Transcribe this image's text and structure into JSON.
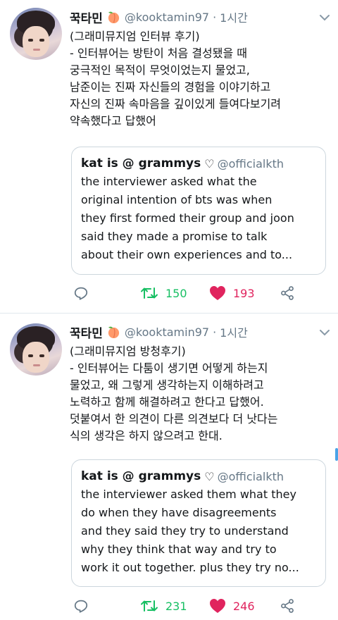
{
  "tweets": [
    {
      "author_name": "꾹타민",
      "handle": "@kooktamin97",
      "separator": "·",
      "time": "1시간",
      "text_lines": [
        "(그래미뮤지엄 인터뷰 후기)",
        "- 인터뷰어는 방탄이 처음 결성됐을 때",
        "궁극적인 목적이 무엇이었는지 물었고,",
        "남준이는 진짜 자신들의 경험을 이야기하고",
        "자신의 진짜 속마음을 깊이있게 들여다보기려",
        "약속했다고 답했어"
      ],
      "quote": {
        "name": "kat is @ grammys",
        "heart": "♡",
        "handle": "@officialkth",
        "lines": [
          "the interviewer asked what the",
          "original intention of bts was when",
          "they first formed their group and joon",
          "said they made a promise to talk",
          "about their own experiences and to..."
        ]
      },
      "retweets": "150",
      "likes": "193"
    },
    {
      "author_name": "꾹타민",
      "handle": "@kooktamin97",
      "separator": "·",
      "time": "1시간",
      "text_lines": [
        "(그래미뮤지엄 방청후기)",
        "- 인터뷰어는 다툼이 생기면 어떻게 하는지",
        "물었고, 왜 그렇게 생각하는지 이해하려고",
        "노력하고 함께 해결하려고 한다고 답했어.",
        "덧붙여서 한 의견이 다른 의견보다 더 낫다는",
        "식의 생각은 하지 않으려고 한대."
      ],
      "quote": {
        "name": "kat is @ grammys",
        "heart": "♡",
        "handle": "@officialkth",
        "lines": [
          "the interviewer asked them what they",
          "do when they have disagreements",
          "and they said they try to understand",
          "why they think that way and try to",
          "work it out together. plus they try no..."
        ]
      },
      "retweets": "231",
      "likes": "246"
    }
  ],
  "colors": {
    "retweet": "#17bf63",
    "like": "#e0245e",
    "muted": "#657786",
    "accent": "#4aa3e8"
  },
  "icons": {
    "reply": "reply-icon",
    "retweet": "retweet-icon",
    "like": "heart-icon",
    "share": "share-icon",
    "more": "chevron-down-icon",
    "emoji": "peach-emoji-icon"
  }
}
